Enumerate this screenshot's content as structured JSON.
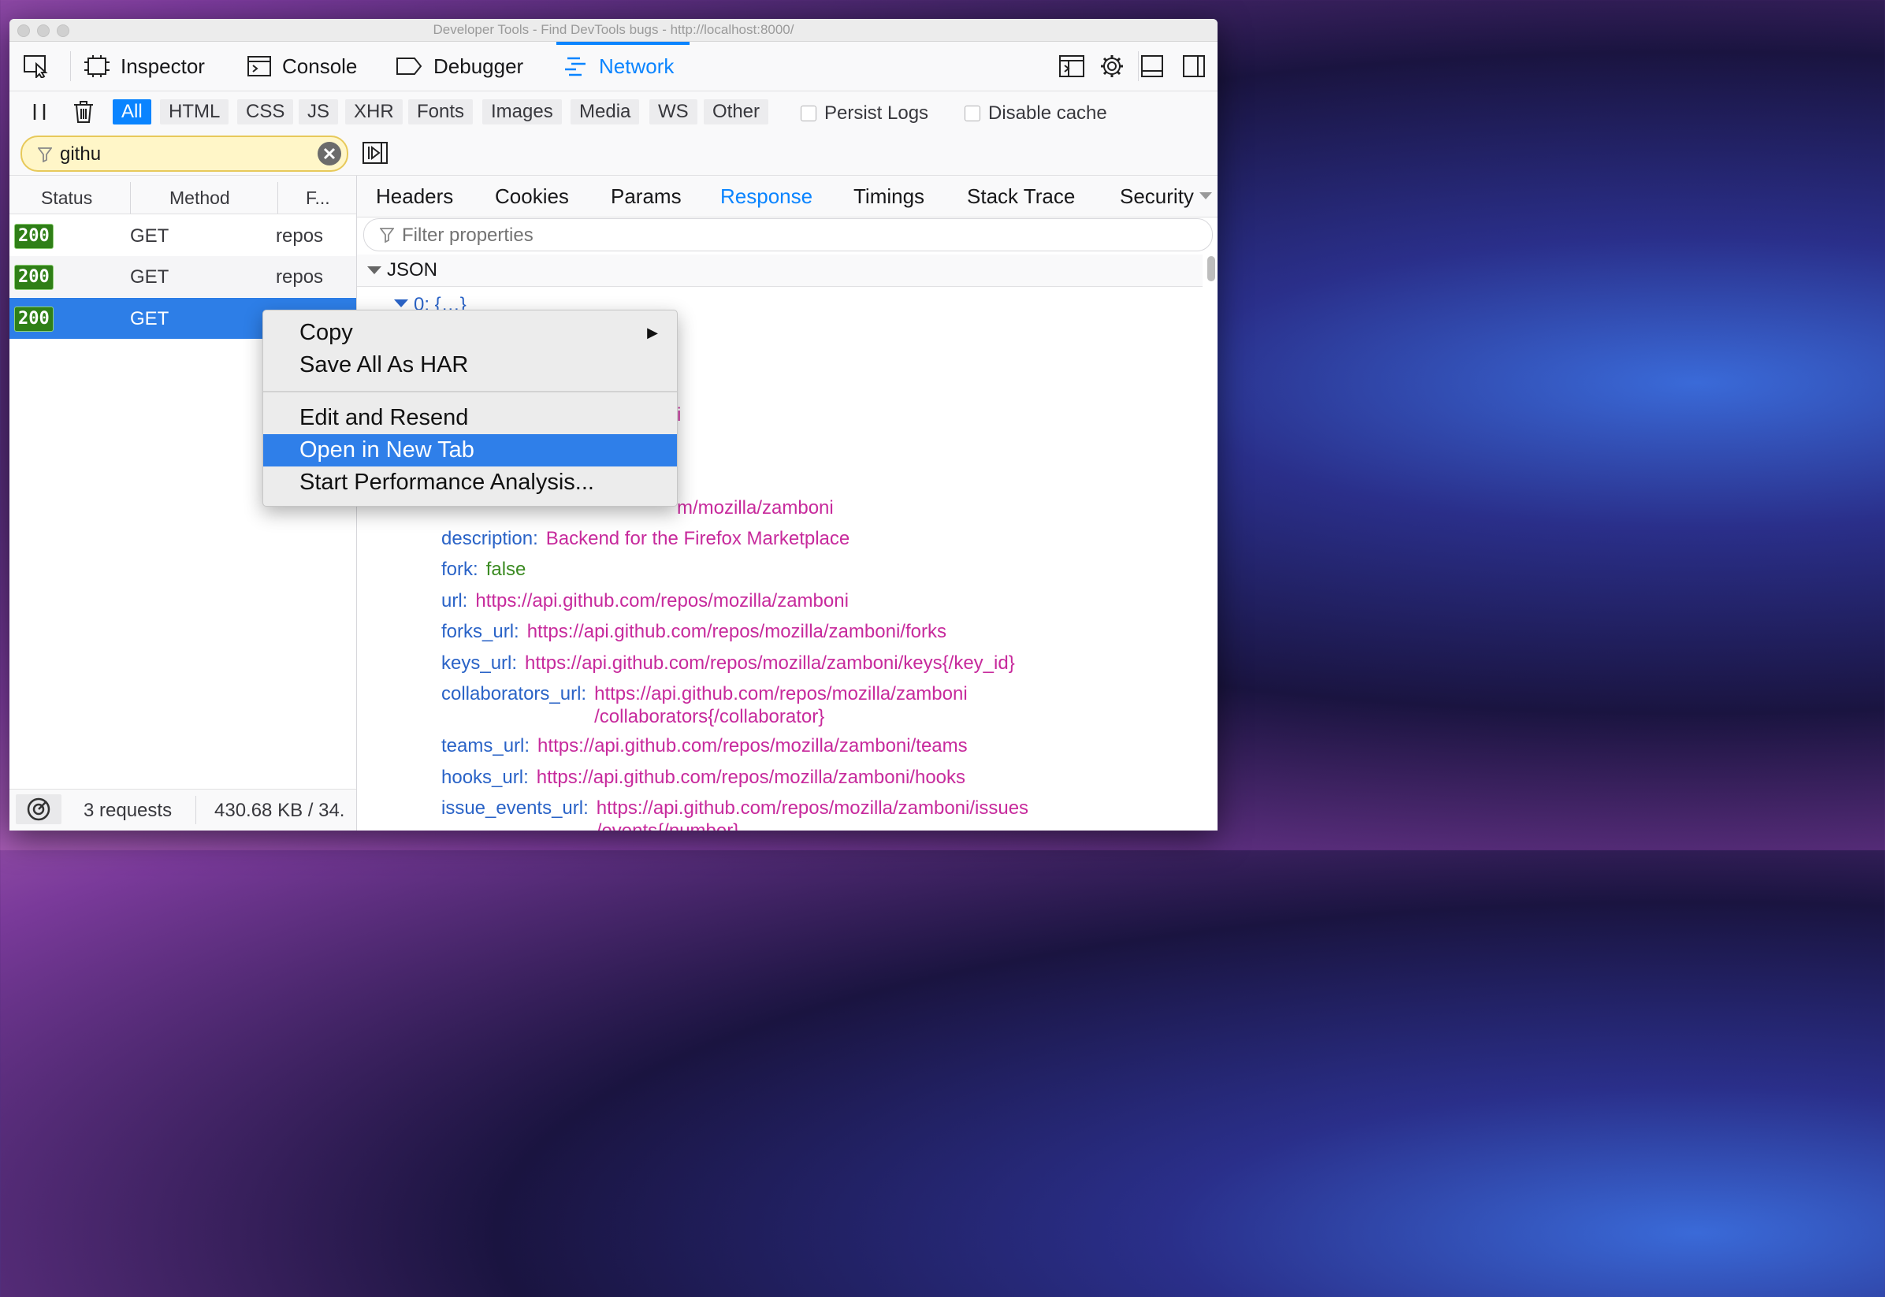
{
  "window": {
    "title": "Developer Tools - Find DevTools bugs - http://localhost:8000/"
  },
  "toolbar": {
    "tabs": [
      {
        "label": "Inspector",
        "icon": "inspector-icon"
      },
      {
        "label": "Console",
        "icon": "console-icon"
      },
      {
        "label": "Debugger",
        "icon": "debugger-icon"
      },
      {
        "label": "Network",
        "icon": "network-icon",
        "active": true
      }
    ]
  },
  "filters": {
    "types": [
      "All",
      "HTML",
      "CSS",
      "JS",
      "XHR",
      "Fonts",
      "Images",
      "Media",
      "WS",
      "Other"
    ],
    "active_type": "All",
    "persist_logs": "Persist Logs",
    "disable_cache": "Disable cache",
    "search_value": "githu"
  },
  "requests": {
    "columns": [
      "Status",
      "Method",
      "F..."
    ],
    "rows": [
      {
        "status": "200",
        "method": "GET",
        "file": "repos"
      },
      {
        "status": "200",
        "method": "GET",
        "file": "repos"
      },
      {
        "status": "200",
        "method": "GET",
        "file": "",
        "selected": true
      }
    ]
  },
  "footer": {
    "requests": "3 requests",
    "size": "430.68 KB / 34."
  },
  "details": {
    "tabs": [
      "Headers",
      "Cookies",
      "Params",
      "Response",
      "Timings",
      "Stack Trace",
      "Security"
    ],
    "active_tab": "Response",
    "filter_placeholder": "Filter properties",
    "json_label": "JSON",
    "node_0": "0: {…}",
    "partial_1": "i",
    "partial_2": "m/mozilla/zamboni",
    "properties": [
      {
        "key": "description:",
        "value": "Backend for the Firefox Marketplace"
      },
      {
        "key": "fork:",
        "value": "false"
      },
      {
        "key": "url:",
        "value": "https://api.github.com/repos/mozilla/zamboni"
      },
      {
        "key": "forks_url:",
        "value": "https://api.github.com/repos/mozilla/zamboni/forks"
      },
      {
        "key": "keys_url:",
        "value": "https://api.github.com/repos/mozilla/zamboni/keys{/key_id}"
      },
      {
        "key": "collaborators_url:",
        "value": "https://api.github.com/repos/mozilla/zamboni",
        "value2": "/collaborators{/collaborator}"
      },
      {
        "key": "teams_url:",
        "value": "https://api.github.com/repos/mozilla/zamboni/teams"
      },
      {
        "key": "hooks_url:",
        "value": "https://api.github.com/repos/mozilla/zamboni/hooks"
      },
      {
        "key": "issue_events_url:",
        "value": "https://api.github.com/repos/mozilla/zamboni/issues",
        "value2": "/events{/number}"
      }
    ]
  },
  "context_menu": {
    "items": [
      "Copy",
      "Save All As HAR",
      "Edit and Resend",
      "Open in New Tab",
      "Start Performance Analysis..."
    ],
    "highlighted": "Open in New Tab"
  },
  "colors": {
    "accent": "#0a84ff",
    "status_ok": "#2f7f17",
    "json_key": "#2a63c7",
    "json_string": "#c72a9c",
    "json_bool": "#3a8a21"
  }
}
